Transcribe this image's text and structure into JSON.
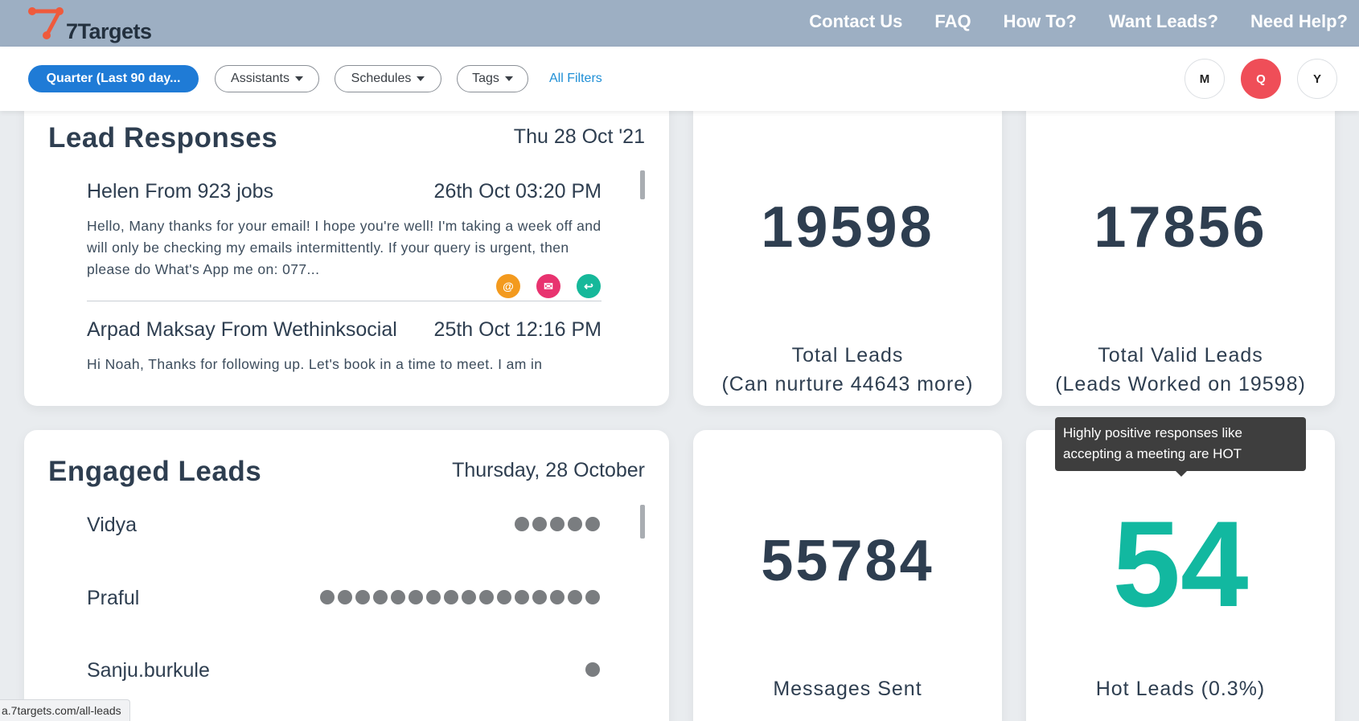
{
  "brand": {
    "name": "7Targets"
  },
  "nav": {
    "links": [
      "Contact Us",
      "FAQ",
      "How To?",
      "Want Leads?",
      "Need Help?"
    ]
  },
  "filters": {
    "period": "Quarter (Last 90 day...",
    "assistants": "Assistants",
    "schedules": "Schedules",
    "tags": "Tags",
    "all_filters": "All Filters",
    "range_buttons": [
      "M",
      "Q",
      "Y"
    ],
    "active_range": "Q"
  },
  "lead_responses": {
    "title": "Lead Responses",
    "date": "Thu 28 Oct '21",
    "items": [
      {
        "name": "Helen From 923 jobs",
        "time": "26th Oct 03:20 PM",
        "body": "Hello, Many thanks for your email! I hope you're well! I'm taking a week off and will only be checking my emails intermittently. If your query is urgent, then please do What's App me on: 077..."
      },
      {
        "name": "Arpad Maksay From Wethinksocial",
        "time": "25th Oct 12:16 PM",
        "body": "Hi Noah, Thanks for following up. Let's book in a time to meet. I am in"
      }
    ],
    "action_icons": [
      {
        "icon": "at-icon",
        "glyph": "@",
        "color": "#f39a1e"
      },
      {
        "icon": "envelope-icon",
        "glyph": "✉",
        "color": "#e8336f"
      },
      {
        "icon": "reply-icon",
        "glyph": "↩",
        "color": "#16b89a"
      }
    ]
  },
  "stats": {
    "total_leads": {
      "value": "19598",
      "label_line1": "Total Leads",
      "label_line2": "(Can nurture 44643 more)"
    },
    "total_valid_leads": {
      "value": "17856",
      "label_line1": "Total Valid Leads",
      "label_line2": "(Leads Worked on 19598)"
    },
    "messages_sent": {
      "value": "55784",
      "label": "Messages Sent"
    },
    "hot_leads": {
      "value": "54",
      "label": "Hot Leads (0.3%)",
      "color": "#12b8a0"
    }
  },
  "engaged_leads": {
    "title": "Engaged Leads",
    "date": "Thursday, 28 October",
    "items": [
      {
        "name": "Vidya",
        "engagement_count": 5
      },
      {
        "name": "Praful",
        "engagement_count": 16
      },
      {
        "name": "Sanju.burkule",
        "engagement_count": 1
      }
    ]
  },
  "tooltip": {
    "text": "Highly positive responses like accepting a meeting are HOT"
  },
  "status_bar": {
    "url": "a.7targets.com/all-leads"
  }
}
